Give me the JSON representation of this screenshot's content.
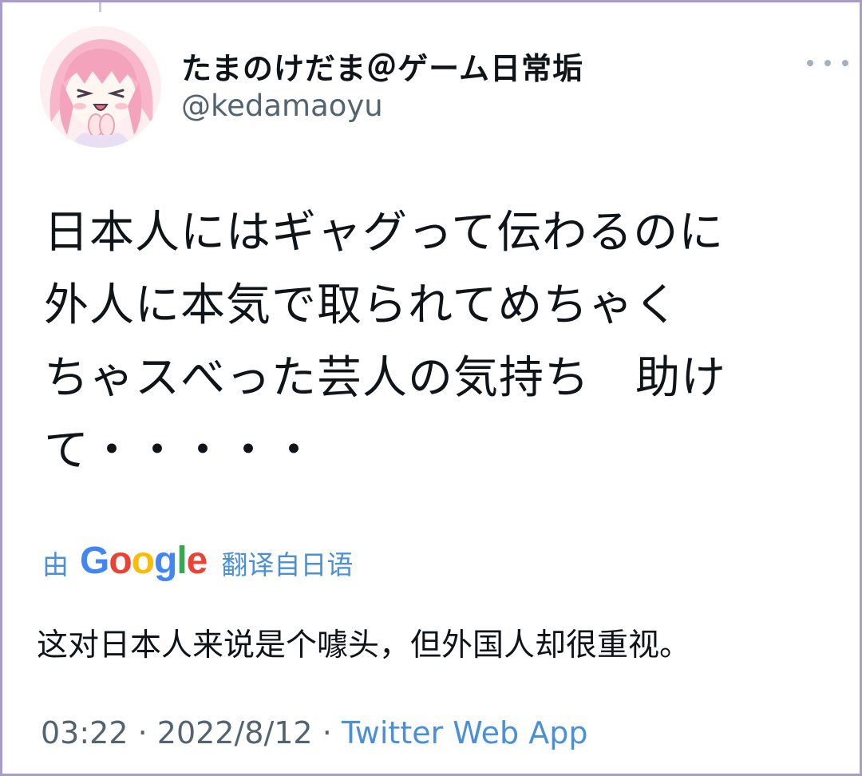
{
  "user": {
    "display_name": "たまのけだま＠ゲーム日常垢",
    "handle": "@kedamaoyu",
    "avatar": "avatar-anime-girl"
  },
  "more_icon": "more-horizontal-icon",
  "tweet": {
    "text": "日本人にはギャグって伝わるのに\n外人に本気で取られてめちゃく\nちゃスべった芸人の気持ち　助け\nて・・・・・"
  },
  "translation": {
    "prefix": "由",
    "provider": "Google",
    "provider_letters": [
      "G",
      "o",
      "o",
      "g",
      "l",
      "e"
    ],
    "provider_colors": [
      "#4285F4",
      "#EA4335",
      "#FBBC05",
      "#4285F4",
      "#34A853",
      "#EA4335"
    ],
    "suffix": "翻译自日语",
    "text": "这对日本人来说是个噱头，但外国人却很重视。"
  },
  "meta": {
    "time": "03:22",
    "separator": " · ",
    "date": "2022/8/12",
    "source": "Twitter Web App"
  },
  "colors": {
    "frame": "#a79ccb",
    "link": "#4a90d9",
    "text": "#0f1419",
    "muted": "#536471"
  }
}
